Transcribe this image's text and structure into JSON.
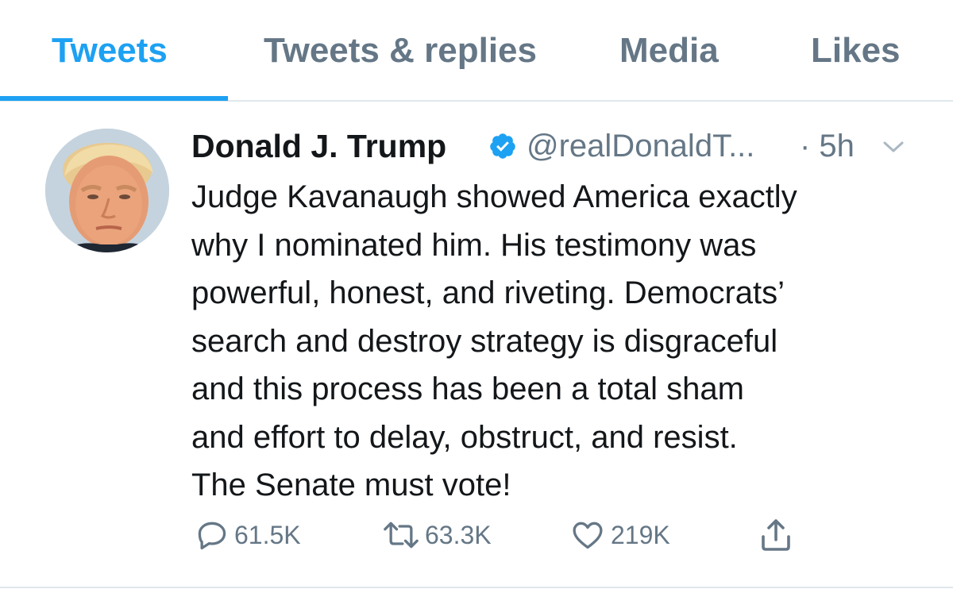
{
  "tabs": [
    {
      "label": "Tweets",
      "active": true
    },
    {
      "label": "Tweets & replies",
      "active": false
    },
    {
      "label": "Media",
      "active": false
    },
    {
      "label": "Likes",
      "active": false
    }
  ],
  "tweet": {
    "author": {
      "display_name": "Donald J. Trump",
      "handle": "@realDonaldT...",
      "verified": true
    },
    "time": "· 5h",
    "text": "Judge Kavanaugh showed America exactly\nwhy I nominated him. His testimony was\npowerful, honest, and riveting. Democrats’\nsearch and destroy strategy is disgraceful\nand this process has been a total sham\nand effort to delay, obstruct, and resist.\nThe Senate must vote!",
    "actions": {
      "replies": "61.5K",
      "retweets": "63.3K",
      "likes": "219K"
    }
  },
  "colors": {
    "accent": "#1da1f2",
    "secondary_text": "#657786",
    "primary_text": "#14171a",
    "divider": "#e1e8ed"
  },
  "icons": [
    "verified-badge-icon",
    "chevron-down-icon",
    "reply-icon",
    "retweet-icon",
    "like-icon",
    "share-icon"
  ]
}
